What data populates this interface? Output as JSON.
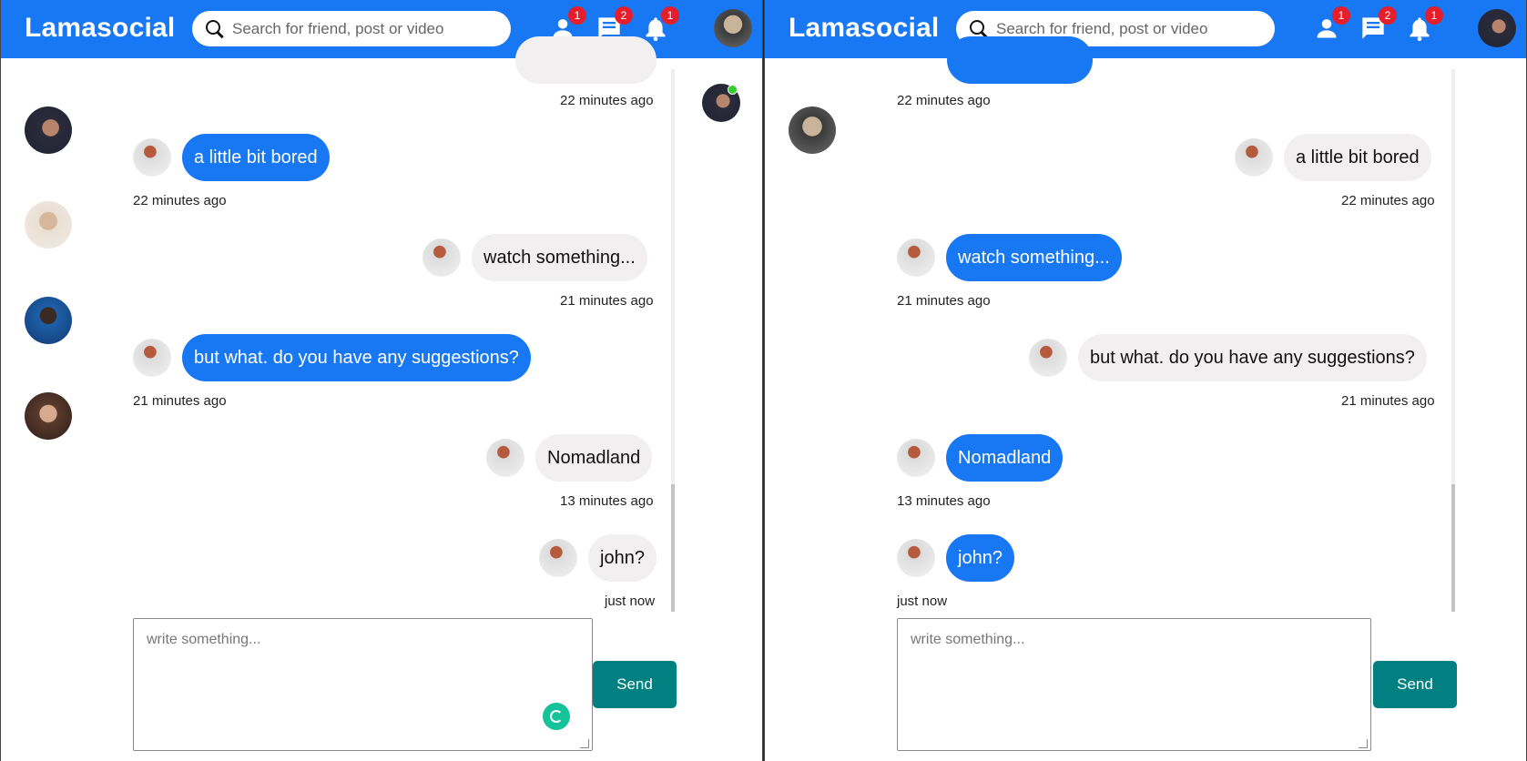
{
  "app": {
    "logo": "Lamasocial"
  },
  "search": {
    "placeholder": "Search for friend, post or video"
  },
  "topbar": {
    "friend_requests": {
      "icon": "person-icon",
      "count": "1"
    },
    "messages": {
      "icon": "chat-icon",
      "count": "2"
    },
    "notifications": {
      "icon": "bell-icon",
      "count": "1"
    }
  },
  "colors": {
    "brand": "#1877f2",
    "badge": "#e41e2a",
    "own_bubble": "#1877f2",
    "other_bubble": "#f2eff0",
    "send": "#008080",
    "online": "#32cd32"
  },
  "left": {
    "partial_time": "22 minutes ago",
    "messages": [
      {
        "text": "a little bit bored",
        "time": "22 minutes ago",
        "own": true
      },
      {
        "text": "watch something...",
        "time": "21 minutes ago",
        "own": false
      },
      {
        "text": "but what. do you have any suggestions?",
        "time": "21 minutes ago",
        "own": true
      },
      {
        "text": "Nomadland",
        "time": "13 minutes ago",
        "own": false
      },
      {
        "text": "john?",
        "time": "just now",
        "own": false
      }
    ]
  },
  "right": {
    "partial_time": "22 minutes ago",
    "messages": [
      {
        "text": "a little bit bored",
        "time": "22 minutes ago",
        "own": false
      },
      {
        "text": "watch something...",
        "time": "21 minutes ago",
        "own": true
      },
      {
        "text": "but what. do you have any suggestions?",
        "time": "21 minutes ago",
        "own": false
      },
      {
        "text": "Nomadland",
        "time": "13 minutes ago",
        "own": true
      },
      {
        "text": "john?",
        "time": "just now",
        "own": true
      }
    ]
  },
  "composer": {
    "placeholder": "write something...",
    "send_label": "Send"
  }
}
